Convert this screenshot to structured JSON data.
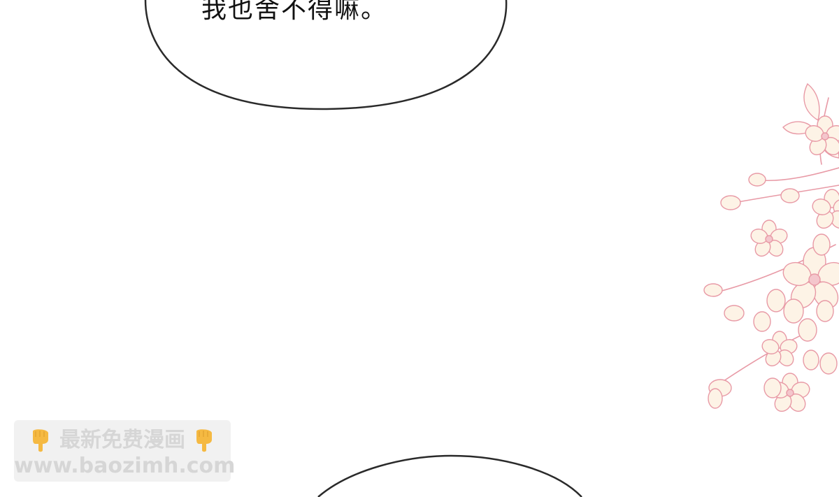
{
  "speech_bubbles": [
    {
      "text": "我也舍不得嘛。"
    },
    {
      "text": ""
    }
  ],
  "watermark": {
    "title": "最新免费漫画",
    "url": "www.baozimh.com",
    "icon": "pointing-down-hand-icon"
  },
  "colors": {
    "bubble_outline": "#2a2a2a",
    "blossom_outline": "#e89aa6",
    "blossom_fill": "#fdf3e6",
    "watermark_bg": "#ececec",
    "watermark_text": "#d6d6d6",
    "hand_icon": "#f5b942"
  }
}
